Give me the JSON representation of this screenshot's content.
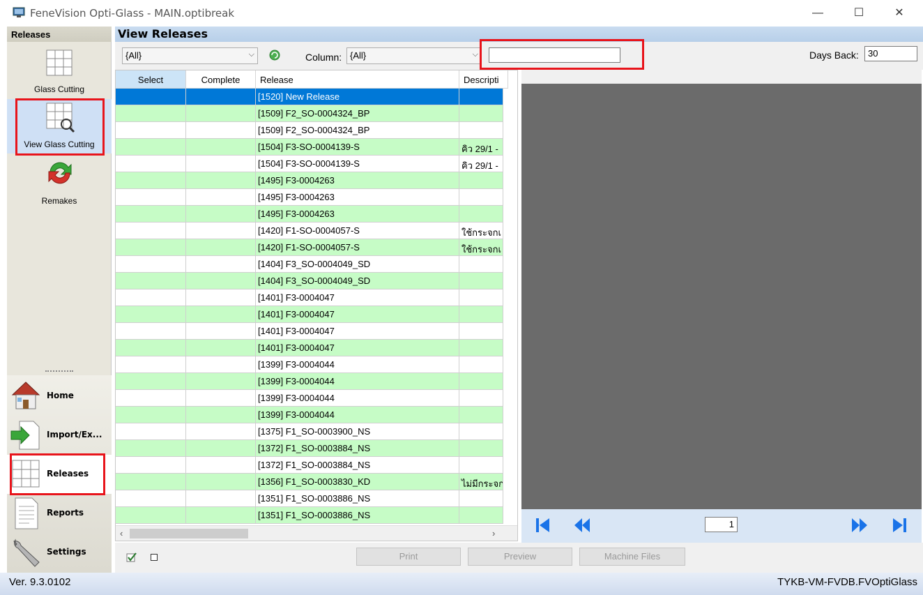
{
  "window": {
    "title": "FeneVision Opti-Glass - MAIN.optibreak",
    "minimize": "—",
    "maximize": "☐",
    "close": "✕"
  },
  "left_panel": {
    "header": "Releases",
    "tools": [
      {
        "label": "Glass Cutting",
        "icon": "grid-icon"
      },
      {
        "label": "View Glass Cutting",
        "icon": "grid-magnifier-icon"
      },
      {
        "label": "Remakes",
        "icon": "recycle-arrows-icon"
      }
    ],
    "nav": [
      {
        "label": "Home",
        "icon": "house-icon"
      },
      {
        "label": "Import/Ex...",
        "icon": "import-arrow-icon"
      },
      {
        "label": "Releases",
        "icon": "grid-icon"
      },
      {
        "label": "Reports",
        "icon": "document-icon"
      },
      {
        "label": "Settings",
        "icon": "wrench-icon"
      }
    ]
  },
  "main": {
    "header": "View Releases",
    "filter": {
      "scope_value": "{All}",
      "column_label": "Column:",
      "column_value": "{All}",
      "search_value": "",
      "days_back_label": "Days Back:",
      "days_back_value": "30"
    },
    "grid": {
      "columns": [
        "Select",
        "Complete",
        "Release",
        "Descripti"
      ],
      "rows": [
        {
          "release": "[1520] New Release",
          "description": "",
          "style": "sel"
        },
        {
          "release": "[1509] F2_SO-0004324_BP",
          "description": "",
          "style": "green"
        },
        {
          "release": "[1509] F2_SO-0004324_BP",
          "description": "",
          "style": "white"
        },
        {
          "release": "[1504] F3-SO-0004139-S",
          "description": "คิว 29/1 -",
          "style": "green"
        },
        {
          "release": "[1504] F3-SO-0004139-S",
          "description": "คิว 29/1 -",
          "style": "white"
        },
        {
          "release": "[1495] F3-0004263",
          "description": "",
          "style": "green"
        },
        {
          "release": "[1495] F3-0004263",
          "description": "",
          "style": "white"
        },
        {
          "release": "[1495] F3-0004263",
          "description": "",
          "style": "green"
        },
        {
          "release": "[1420] F1-SO-0004057-S",
          "description": "ใช้กระจกเ",
          "style": "white"
        },
        {
          "release": "[1420] F1-SO-0004057-S",
          "description": "ใช้กระจกเ",
          "style": "green"
        },
        {
          "release": "[1404] F3_SO-0004049_SD",
          "description": "",
          "style": "white"
        },
        {
          "release": "[1404] F3_SO-0004049_SD",
          "description": "",
          "style": "green"
        },
        {
          "release": "[1401] F3-0004047",
          "description": "",
          "style": "white"
        },
        {
          "release": "[1401] F3-0004047",
          "description": "",
          "style": "green"
        },
        {
          "release": "[1401] F3-0004047",
          "description": "",
          "style": "white"
        },
        {
          "release": "[1401] F3-0004047",
          "description": "",
          "style": "green"
        },
        {
          "release": "[1399] F3-0004044",
          "description": "",
          "style": "white"
        },
        {
          "release": "[1399] F3-0004044",
          "description": "",
          "style": "green"
        },
        {
          "release": "[1399] F3-0004044",
          "description": "",
          "style": "white"
        },
        {
          "release": "[1399] F3-0004044",
          "description": "",
          "style": "green"
        },
        {
          "release": "[1375] F1_SO-0003900_NS",
          "description": "",
          "style": "white"
        },
        {
          "release": "[1372] F1_SO-0003884_NS",
          "description": "",
          "style": "green"
        },
        {
          "release": "[1372] F1_SO-0003884_NS",
          "description": "",
          "style": "white"
        },
        {
          "release": "[1356]  F1_SO-0003830_KD",
          "description": "ไม่มีกระจก",
          "style": "green"
        },
        {
          "release": "[1351] F1_SO-0003886_NS",
          "description": "",
          "style": "white"
        },
        {
          "release": "[1351] F1_SO-0003886_NS",
          "description": "",
          "style": "green"
        }
      ]
    },
    "preview": {
      "page_value": "1"
    },
    "buttons": {
      "print": "Print",
      "preview": "Preview",
      "machine_files": "Machine Files"
    }
  },
  "status": {
    "version": "Ver. 9.3.0102",
    "database": "TYKB-VM-FVDB.FVOptiGlass"
  },
  "colors": {
    "row_green": "#c6fcc6",
    "row_selected": "#0078d7",
    "highlight_box": "#e8141b",
    "nav_arrow": "#1a73e8"
  }
}
